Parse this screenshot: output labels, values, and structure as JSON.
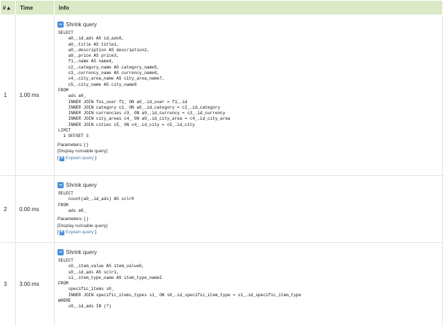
{
  "headers": {
    "num": "#▲",
    "time": "Time",
    "info": "Info"
  },
  "ui": {
    "shrink": "Shrink query",
    "runnable": "[Display runnable query]",
    "explain": "Explain query",
    "bracket_open": "[",
    "bracket_close": "]"
  },
  "rows": [
    {
      "num": "1",
      "time": "1.00 ms",
      "params": "Parameters: { }",
      "sql": [
        "SELECT",
        "    a0_.id_ads AS id_ads0,",
        "    a0_.title AS title1,",
        "    a0_.description AS description2,",
        "    a0_.price AS price3,",
        "    f1_.name AS name4,",
        "    c2_.category_name AS category_name5,",
        "    c3_.currency_name AS currency_name6,",
        "    c4_.city_area_name AS city_area_name7,",
        "    c5_.city_name AS city_name8",
        "FROM",
        "    ads a0_",
        "    INNER JOIN fos_user f1_ ON a0_.id_user = f1_.id",
        "    INNER JOIN category c2_ ON a0_.id_category = c2_.id_category",
        "    INNER JOIN currencies c3_ ON a0_.id_currency = c3_.id_currency",
        "    INNER JOIN city_areas c4_ ON a0_.id_city_area = c4_.id_city_area",
        "    INNER JOIN cities c5_ ON c4_.id_city = c5_.id_city",
        "LIMIT",
        "  1 OFFSET 3"
      ]
    },
    {
      "num": "2",
      "time": "0.00 ms",
      "params": "Parameters: { }",
      "sql": [
        "SELECT",
        "    count(a0_.id_ads) AS sclr0",
        "FROM",
        "    ads a0_"
      ]
    },
    {
      "num": "3",
      "time": "3.00 ms",
      "params": "",
      "sql": [
        "SELECT",
        "    s0_.item_value AS item_value0,",
        "    s0_.id_ads AS sclr1,",
        "    s1_.item_type_name AS item_type_name2",
        "FROM",
        "    specific_items s0_",
        "    INNER JOIN specific_items_types s1_ ON s0_.id_specific_item_type = s1_.id_specific_item_type",
        "WHERE",
        "    s0_.id_ads IN (?)"
      ]
    }
  ]
}
